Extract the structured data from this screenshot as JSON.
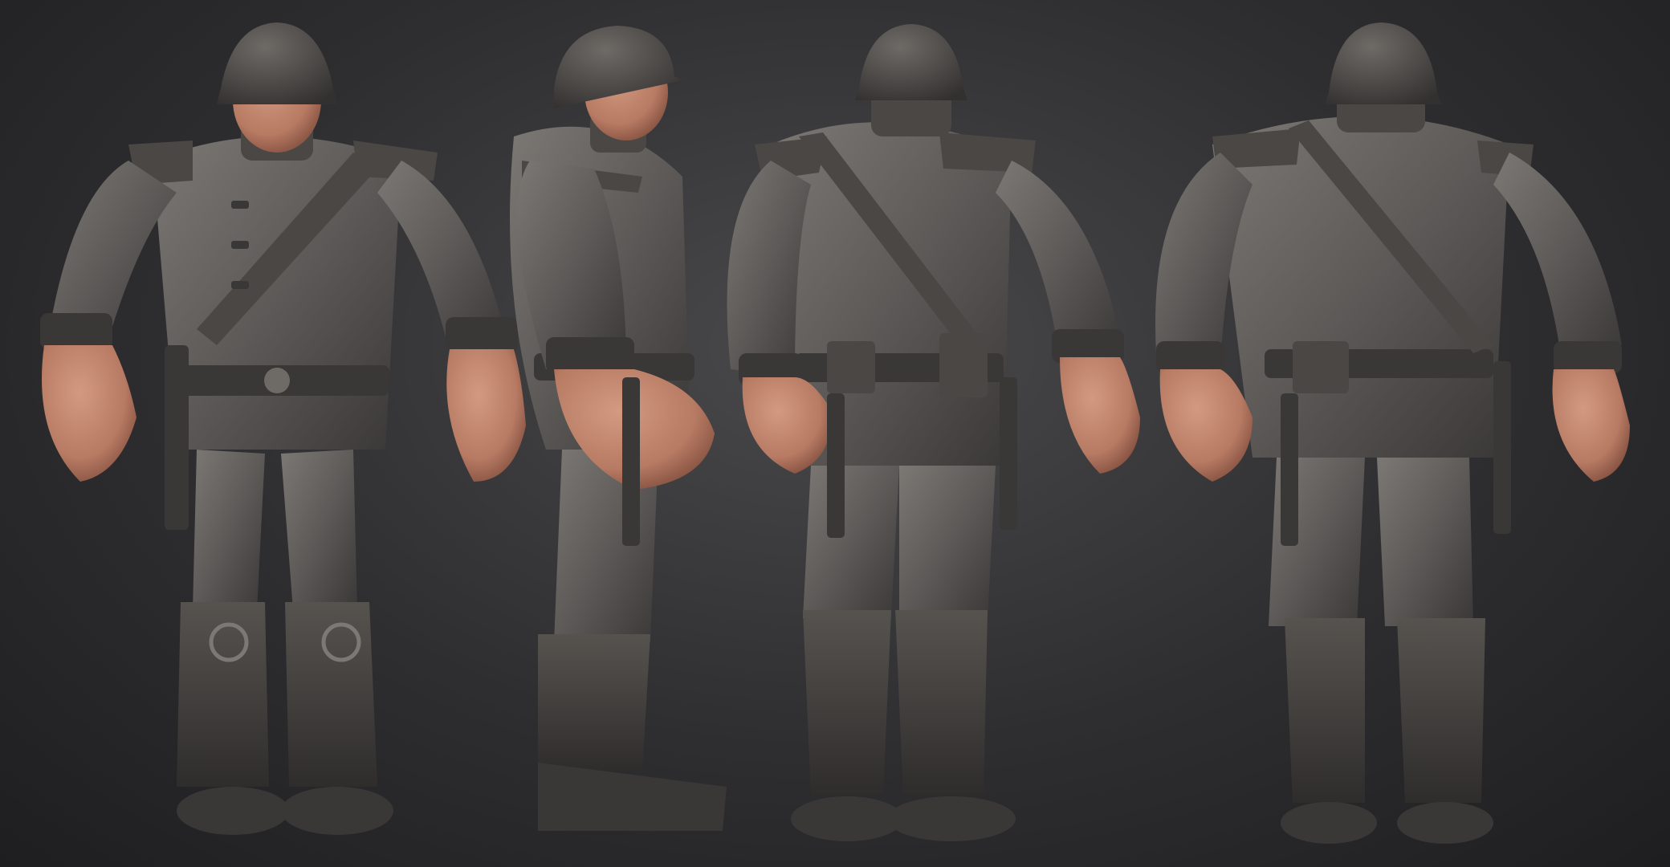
{
  "scene": {
    "background_top": "#4a4a4c",
    "background_bottom": "#1e1e20",
    "clay_color": "#5d5a58",
    "clay_shadow": "#3a3837",
    "clay_highlight": "#8a8683",
    "skin_color": "#b77a63",
    "skin_shadow": "#7a4a3a",
    "views": [
      {
        "name": "front"
      },
      {
        "name": "side"
      },
      {
        "name": "back-three-quarter"
      },
      {
        "name": "back"
      }
    ]
  }
}
